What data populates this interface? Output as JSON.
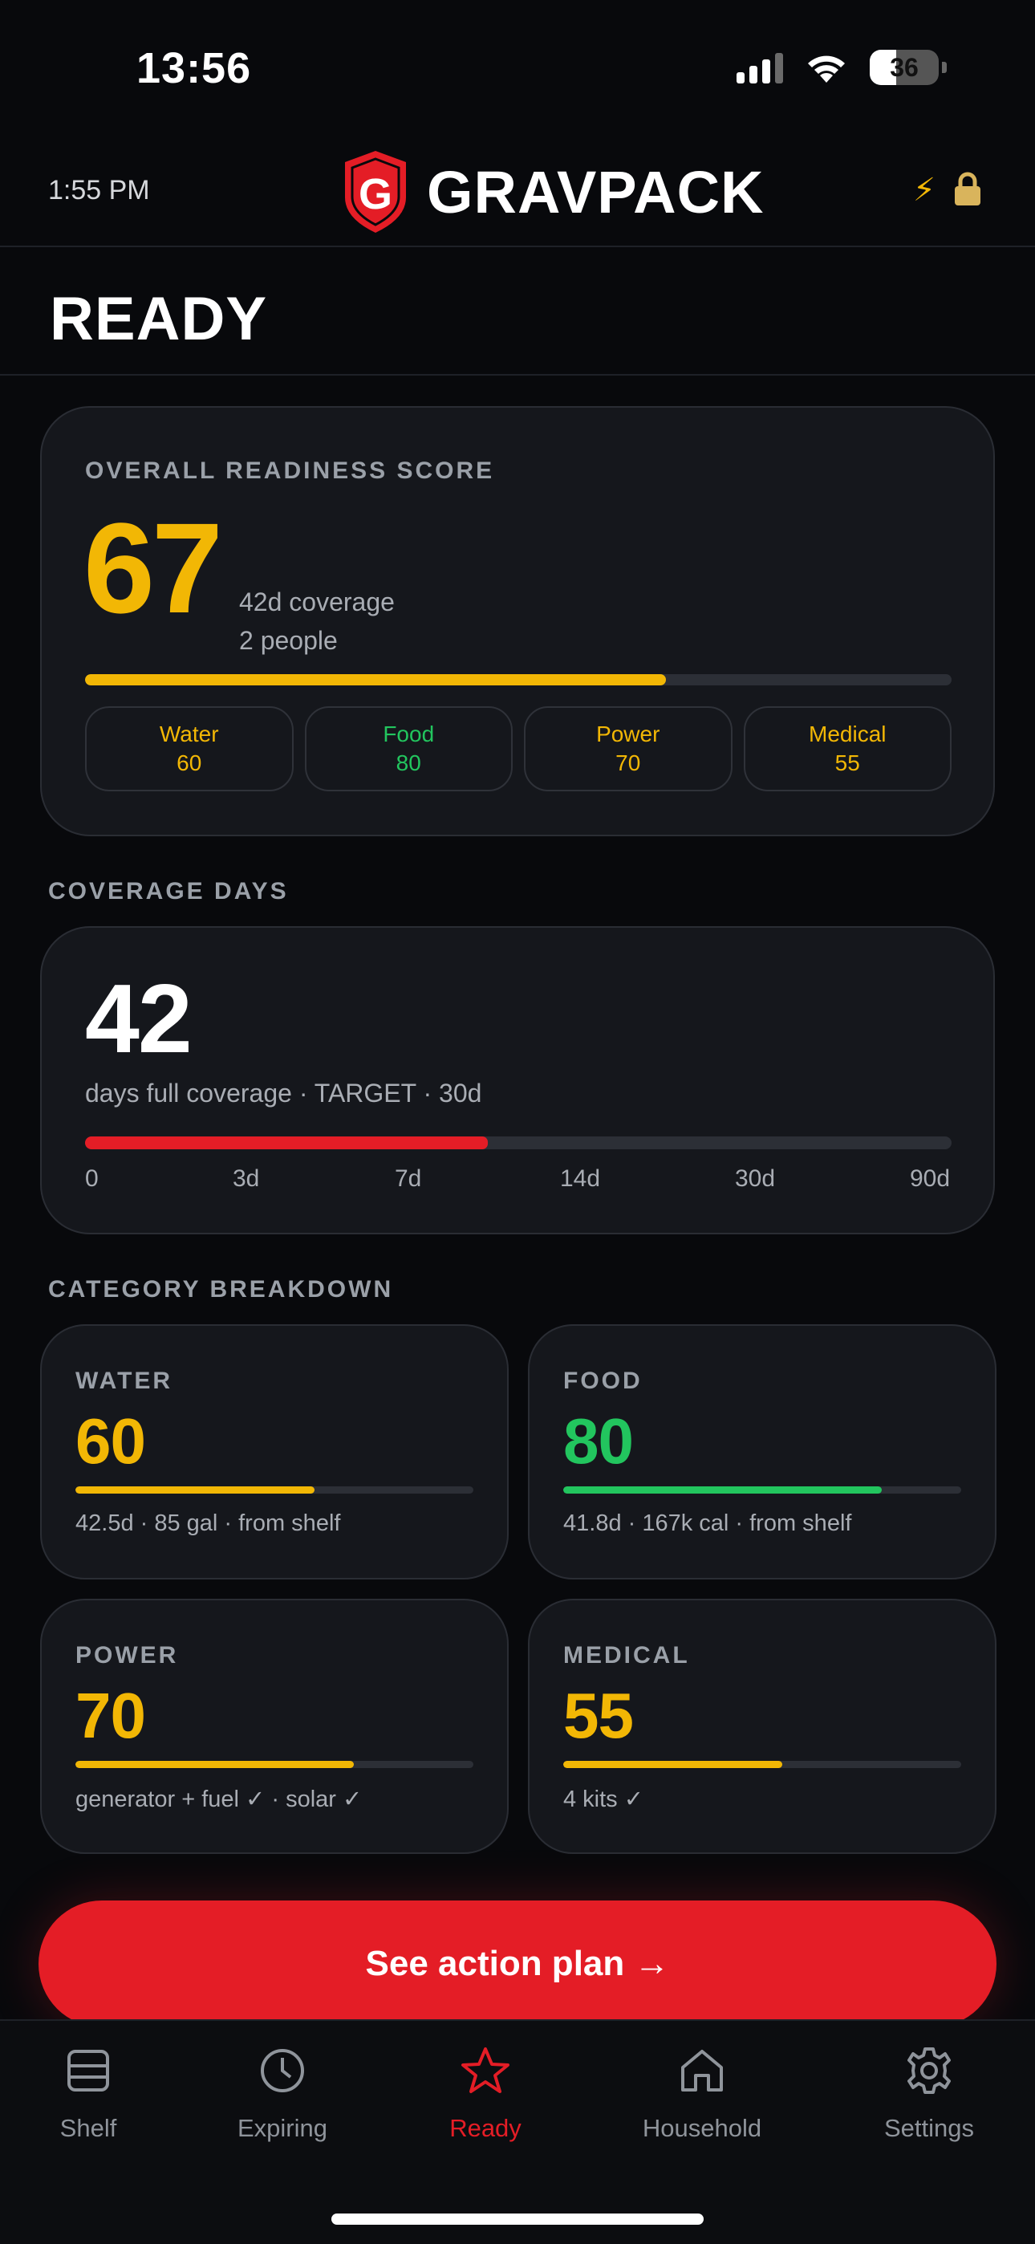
{
  "status_bar": {
    "time": "13:56",
    "battery": "36"
  },
  "header": {
    "time": "1:55 PM",
    "brand_letter": "G",
    "brand": "GRAVPACK",
    "icons": [
      "bolt-icon",
      "lock-icon"
    ]
  },
  "page_title": "READY",
  "readiness": {
    "label": "OVERALL READINESS SCORE",
    "score": "67",
    "score_value": 67,
    "coverage_text": "42d coverage",
    "people_text": "2 people",
    "chips": [
      {
        "name": "Water",
        "value": "60",
        "color": "#f2b705"
      },
      {
        "name": "Food",
        "value": "80",
        "color": "#22c55e"
      },
      {
        "name": "Power",
        "value": "70",
        "color": "#f2b705"
      },
      {
        "name": "Medical",
        "value": "55",
        "color": "#f2b705"
      }
    ]
  },
  "coverage": {
    "section_label": "COVERAGE DAYS",
    "days": "42",
    "subtitle": "days full coverage · TARGET · 30d",
    "bar_fill_fraction": 0.465,
    "ticks": [
      "0",
      "3d",
      "7d",
      "14d",
      "30d",
      "90d"
    ]
  },
  "categories": {
    "section_label": "CATEGORY BREAKDOWN",
    "items": [
      {
        "label": "WATER",
        "value": "60",
        "fill": 0.6,
        "detail": "42.5d · 85 gal · from shelf",
        "color": "#f2b705"
      },
      {
        "label": "FOOD",
        "value": "80",
        "fill": 0.8,
        "detail": "41.8d · 167k cal · from shelf",
        "color": "#22c55e"
      },
      {
        "label": "POWER",
        "value": "70",
        "fill": 0.7,
        "detail": "generator + fuel ✓ · solar ✓",
        "color": "#f2b705"
      },
      {
        "label": "MEDICAL",
        "value": "55",
        "fill": 0.55,
        "detail": "4 kits ✓",
        "color": "#f2b705"
      }
    ]
  },
  "cta": "See action plan →",
  "tabs": [
    {
      "label": "Shelf",
      "icon": "shelf-icon",
      "active": false
    },
    {
      "label": "Expiring",
      "icon": "clock-icon",
      "active": false
    },
    {
      "label": "Ready",
      "icon": "star-icon",
      "active": true
    },
    {
      "label": "Household",
      "icon": "house-icon",
      "active": false
    },
    {
      "label": "Settings",
      "icon": "gear-icon",
      "active": false
    }
  ],
  "colors": {
    "accent_red": "#e41d26",
    "yellow": "#f2b705",
    "green": "#22c55e",
    "background": "#08090c",
    "card": "#15171c"
  }
}
